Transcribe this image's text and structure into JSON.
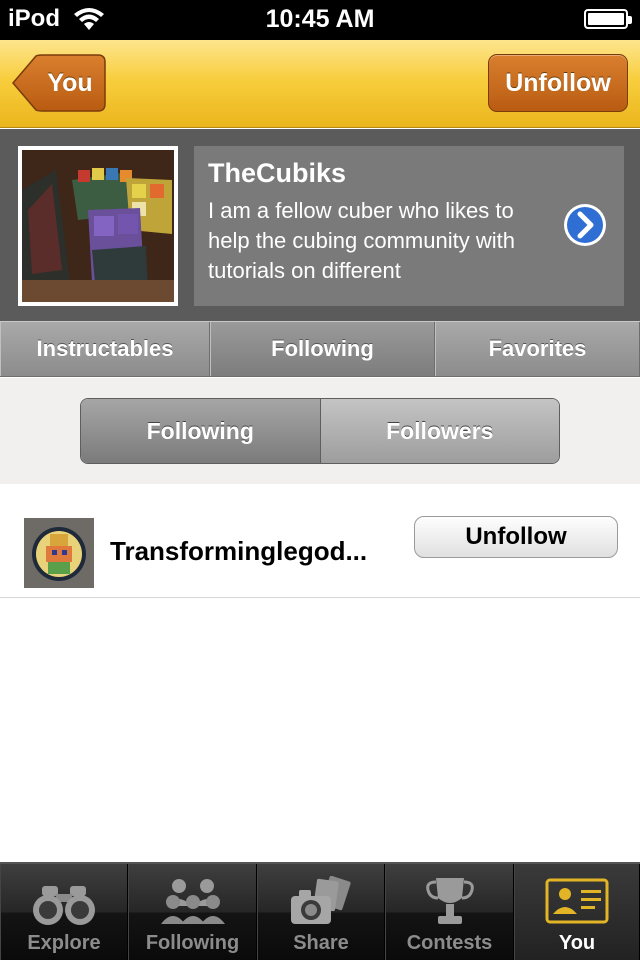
{
  "status": {
    "carrier": "iPod",
    "time": "10:45 AM"
  },
  "nav": {
    "back_label": "You",
    "action_label": "Unfollow"
  },
  "profile": {
    "name": "TheCubiks",
    "bio": "I am a fellow cuber who likes to help the cubing community with tutorials on different",
    "arrow_icon": "chevron-right-circle-icon"
  },
  "tabs": [
    {
      "label": "Instructables",
      "active": false
    },
    {
      "label": "Following",
      "active": true
    },
    {
      "label": "Favorites",
      "active": false
    }
  ],
  "subsegment": [
    {
      "label": "Following",
      "active": true
    },
    {
      "label": "Followers",
      "active": false
    }
  ],
  "list": [
    {
      "username": "Transforminglegod...",
      "button_label": "Unfollow"
    }
  ],
  "tabbar": [
    {
      "label": "Explore",
      "icon": "binoculars-icon",
      "active": false
    },
    {
      "label": "Following",
      "icon": "people-icon",
      "active": false
    },
    {
      "label": "Share",
      "icon": "camera-photos-icon",
      "active": false
    },
    {
      "label": "Contests",
      "icon": "trophy-icon",
      "active": false
    },
    {
      "label": "You",
      "icon": "id-card-icon",
      "active": true
    }
  ],
  "colors": {
    "nav_yellow": "#f8ce3e",
    "button_orange": "#c7691c",
    "profile_gray": "#5b5b5b",
    "link_blue": "#2f6fd4"
  }
}
